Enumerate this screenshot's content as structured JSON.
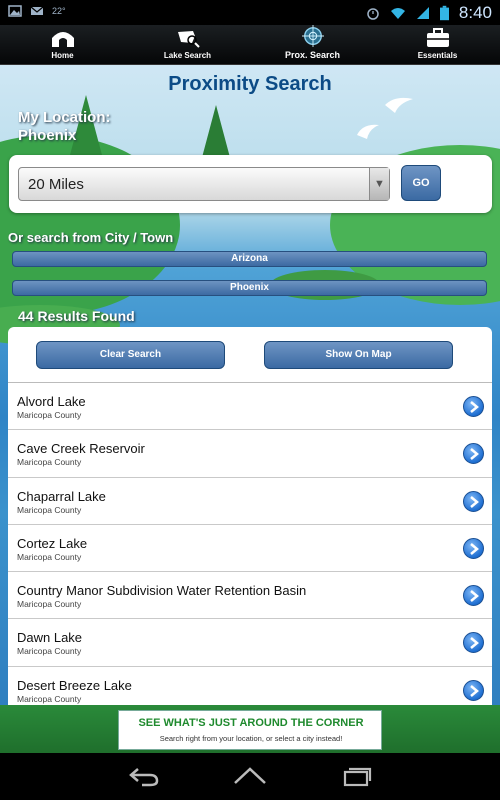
{
  "status_bar": {
    "temperature": "22°",
    "time": "8:40",
    "icons": [
      "image-icon",
      "mail-icon",
      "alarm-icon",
      "wifi-icon",
      "signal-icon",
      "battery-icon"
    ]
  },
  "tabs": [
    {
      "label": "Home",
      "icon": "home-icon"
    },
    {
      "label": "Lake Search",
      "icon": "lake-search-icon"
    },
    {
      "label": "Prox. Search",
      "icon": "crosshair-icon",
      "active": true
    },
    {
      "label": "Essentials",
      "icon": "toolbox-icon"
    }
  ],
  "page": {
    "title": "Proximity Search",
    "location_label": "My Location:",
    "location_value": "Phoenix"
  },
  "radius": {
    "selected": "20 Miles",
    "go_label": "GO"
  },
  "city_search": {
    "label": "Or search from City / Town",
    "state": "Arizona",
    "city": "Phoenix"
  },
  "results": {
    "count_label": "44 Results Found",
    "clear_label": "Clear Search",
    "map_label": "Show On Map",
    "lakes": [
      {
        "name": "Alvord Lake",
        "county": "Maricopa County"
      },
      {
        "name": "Cave Creek Reservoir",
        "county": "Maricopa County"
      },
      {
        "name": "Chaparral Lake",
        "county": "Maricopa County"
      },
      {
        "name": "Cortez Lake",
        "county": "Maricopa County"
      },
      {
        "name": "Country Manor Subdivision Water Retention Basin",
        "county": "Maricopa County"
      },
      {
        "name": "Dawn Lake",
        "county": "Maricopa County"
      },
      {
        "name": "Desert Breeze Lake",
        "county": "Maricopa County"
      }
    ]
  },
  "banner": {
    "headline": "SEE WHAT'S JUST AROUND THE CORNER",
    "subtext": "Search right from your location, or select a city instead!"
  },
  "colors": {
    "title_blue": "#0c4b86",
    "button_blue": "#3b6aa3",
    "banner_green": "#1f8a2e",
    "chevron_blue": "#1f6fd2"
  }
}
